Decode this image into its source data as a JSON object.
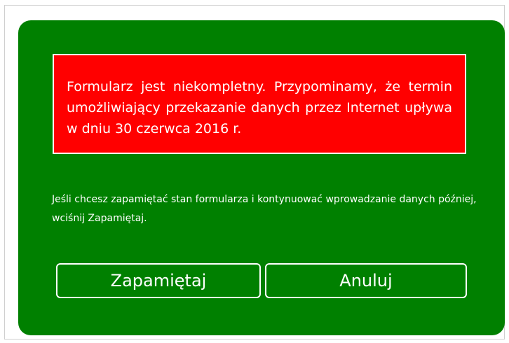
{
  "alert": {
    "message": "Formularz jest niekompletny. Przypominamy, że termin umożliwiający przekazanie danych przez Internet upływa w dniu 30 czerwca 2016 r."
  },
  "info": {
    "message": "Jeśli chcesz zapamiętać stan formularza i kontynuować wprowadzanie danych później, wciśnij Zapamiętaj."
  },
  "buttons": {
    "save_label": "Zapamiętaj",
    "cancel_label": "Anuluj"
  },
  "colors": {
    "dialog_background": "#008000",
    "alert_background": "#ff0000",
    "text": "#ffffff"
  }
}
